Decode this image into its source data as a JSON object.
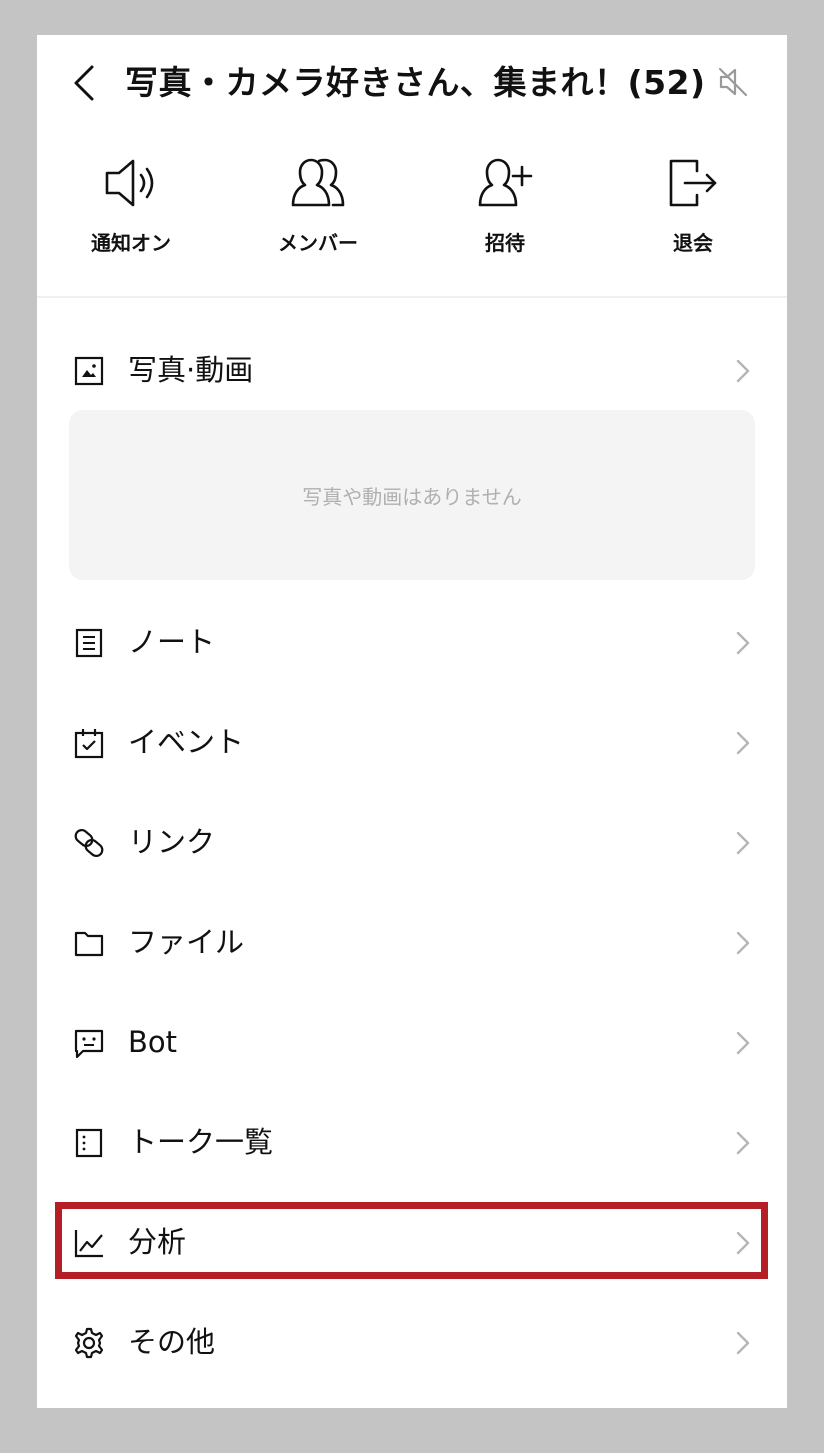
{
  "header": {
    "back_icon": "chevron-left-icon",
    "title": "写真・カメラ好きさん、集まれ！(52)",
    "mute_icon": "speaker-muted-icon"
  },
  "actions": [
    {
      "label": "通知オン",
      "icon": "speaker-on-icon"
    },
    {
      "label": "メンバー",
      "icon": "members-icon"
    },
    {
      "label": "招待",
      "icon": "add-person-icon"
    },
    {
      "label": "退会",
      "icon": "leave-icon"
    }
  ],
  "photos": {
    "label": "写真·動画",
    "icon": "photo-icon",
    "empty_text": "写真や動画はありません"
  },
  "menu": [
    {
      "label": "ノート",
      "icon": "note-icon"
    },
    {
      "label": "イベント",
      "icon": "calendar-check-icon"
    },
    {
      "label": "リンク",
      "icon": "link-icon"
    },
    {
      "label": "ファイル",
      "icon": "folder-icon"
    },
    {
      "label": "Bot",
      "icon": "bot-icon"
    },
    {
      "label": "トーク一覧",
      "icon": "talk-list-icon"
    },
    {
      "label": "分析",
      "icon": "chart-icon"
    },
    {
      "label": "その他",
      "icon": "gear-icon"
    }
  ],
  "colors": {
    "highlight": "#b31f24",
    "chevron": "#b5b5b5",
    "empty_bg": "#f4f4f4",
    "empty_text": "#b0b0b0"
  }
}
